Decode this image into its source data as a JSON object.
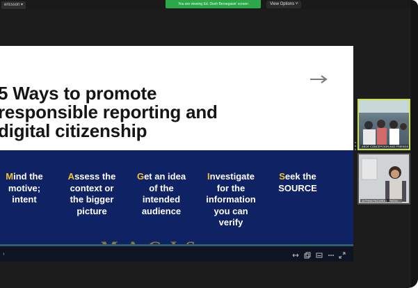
{
  "window": {
    "zoom_chip_label": "ericsson ▾",
    "share_banner": "You are viewing Ed. Dexh Bersegawe' screen",
    "view_options_label": "View Options ˅"
  },
  "slide": {
    "title_line1": "5 Ways to promote",
    "title_line2": "responsible reporting and",
    "title_line3": "digital citizenship",
    "tips": [
      {
        "initial": "M",
        "rest_line1": "ind the",
        "line2": "motive;",
        "line3": "intent",
        "line4": ""
      },
      {
        "initial": "A",
        "rest_line1": "ssess the",
        "line2": "context or",
        "line3": "the bigger",
        "line4": "picture"
      },
      {
        "initial": "G",
        "rest_line1": "et an idea",
        "line2": "of the",
        "line3": "intended",
        "line4": "audience"
      },
      {
        "initial": "I",
        "rest_line1": "nvestigate",
        "line2": "for the",
        "line3": "information",
        "line4": "you can",
        "line5": "verify"
      },
      {
        "initial": "S",
        "rest_line1": "eek the",
        "line2": "SOURCE",
        "line3": "",
        "line4": ""
      }
    ],
    "watermark": "MAGIS"
  },
  "controls": {
    "left_glyph": "›"
  },
  "participants": [
    {
      "label": "ASOF CONCEPCION AND FRIENDS"
    },
    {
      "label": "JUTHNA FACUNDO · FACUL..."
    }
  ],
  "icons": {
    "next_slide": "arrow-right-icon",
    "ctrl_1": "fit-screen-icon",
    "ctrl_2": "copy-icon",
    "ctrl_3": "captions-icon",
    "ctrl_4": "more-icon",
    "ctrl_5": "fullscreen-icon"
  },
  "colors": {
    "navy": "#0f2264",
    "accent_yellow": "#f2c230",
    "share_green": "#2ca84a",
    "tile_highlight": "#c9e04a"
  }
}
